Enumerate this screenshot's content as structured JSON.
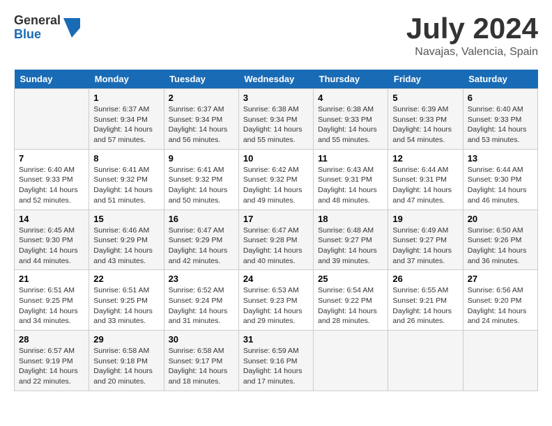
{
  "logo": {
    "general": "General",
    "blue": "Blue"
  },
  "title": "July 2024",
  "subtitle": "Navajas, Valencia, Spain",
  "days_header": [
    "Sunday",
    "Monday",
    "Tuesday",
    "Wednesday",
    "Thursday",
    "Friday",
    "Saturday"
  ],
  "weeks": [
    [
      {
        "day": "",
        "sunrise": "",
        "sunset": "",
        "daylight": ""
      },
      {
        "day": "1",
        "sunrise": "Sunrise: 6:37 AM",
        "sunset": "Sunset: 9:34 PM",
        "daylight": "Daylight: 14 hours and 57 minutes."
      },
      {
        "day": "2",
        "sunrise": "Sunrise: 6:37 AM",
        "sunset": "Sunset: 9:34 PM",
        "daylight": "Daylight: 14 hours and 56 minutes."
      },
      {
        "day": "3",
        "sunrise": "Sunrise: 6:38 AM",
        "sunset": "Sunset: 9:34 PM",
        "daylight": "Daylight: 14 hours and 55 minutes."
      },
      {
        "day": "4",
        "sunrise": "Sunrise: 6:38 AM",
        "sunset": "Sunset: 9:33 PM",
        "daylight": "Daylight: 14 hours and 55 minutes."
      },
      {
        "day": "5",
        "sunrise": "Sunrise: 6:39 AM",
        "sunset": "Sunset: 9:33 PM",
        "daylight": "Daylight: 14 hours and 54 minutes."
      },
      {
        "day": "6",
        "sunrise": "Sunrise: 6:40 AM",
        "sunset": "Sunset: 9:33 PM",
        "daylight": "Daylight: 14 hours and 53 minutes."
      }
    ],
    [
      {
        "day": "7",
        "sunrise": "Sunrise: 6:40 AM",
        "sunset": "Sunset: 9:33 PM",
        "daylight": "Daylight: 14 hours and 52 minutes."
      },
      {
        "day": "8",
        "sunrise": "Sunrise: 6:41 AM",
        "sunset": "Sunset: 9:32 PM",
        "daylight": "Daylight: 14 hours and 51 minutes."
      },
      {
        "day": "9",
        "sunrise": "Sunrise: 6:41 AM",
        "sunset": "Sunset: 9:32 PM",
        "daylight": "Daylight: 14 hours and 50 minutes."
      },
      {
        "day": "10",
        "sunrise": "Sunrise: 6:42 AM",
        "sunset": "Sunset: 9:32 PM",
        "daylight": "Daylight: 14 hours and 49 minutes."
      },
      {
        "day": "11",
        "sunrise": "Sunrise: 6:43 AM",
        "sunset": "Sunset: 9:31 PM",
        "daylight": "Daylight: 14 hours and 48 minutes."
      },
      {
        "day": "12",
        "sunrise": "Sunrise: 6:44 AM",
        "sunset": "Sunset: 9:31 PM",
        "daylight": "Daylight: 14 hours and 47 minutes."
      },
      {
        "day": "13",
        "sunrise": "Sunrise: 6:44 AM",
        "sunset": "Sunset: 9:30 PM",
        "daylight": "Daylight: 14 hours and 46 minutes."
      }
    ],
    [
      {
        "day": "14",
        "sunrise": "Sunrise: 6:45 AM",
        "sunset": "Sunset: 9:30 PM",
        "daylight": "Daylight: 14 hours and 44 minutes."
      },
      {
        "day": "15",
        "sunrise": "Sunrise: 6:46 AM",
        "sunset": "Sunset: 9:29 PM",
        "daylight": "Daylight: 14 hours and 43 minutes."
      },
      {
        "day": "16",
        "sunrise": "Sunrise: 6:47 AM",
        "sunset": "Sunset: 9:29 PM",
        "daylight": "Daylight: 14 hours and 42 minutes."
      },
      {
        "day": "17",
        "sunrise": "Sunrise: 6:47 AM",
        "sunset": "Sunset: 9:28 PM",
        "daylight": "Daylight: 14 hours and 40 minutes."
      },
      {
        "day": "18",
        "sunrise": "Sunrise: 6:48 AM",
        "sunset": "Sunset: 9:27 PM",
        "daylight": "Daylight: 14 hours and 39 minutes."
      },
      {
        "day": "19",
        "sunrise": "Sunrise: 6:49 AM",
        "sunset": "Sunset: 9:27 PM",
        "daylight": "Daylight: 14 hours and 37 minutes."
      },
      {
        "day": "20",
        "sunrise": "Sunrise: 6:50 AM",
        "sunset": "Sunset: 9:26 PM",
        "daylight": "Daylight: 14 hours and 36 minutes."
      }
    ],
    [
      {
        "day": "21",
        "sunrise": "Sunrise: 6:51 AM",
        "sunset": "Sunset: 9:25 PM",
        "daylight": "Daylight: 14 hours and 34 minutes."
      },
      {
        "day": "22",
        "sunrise": "Sunrise: 6:51 AM",
        "sunset": "Sunset: 9:25 PM",
        "daylight": "Daylight: 14 hours and 33 minutes."
      },
      {
        "day": "23",
        "sunrise": "Sunrise: 6:52 AM",
        "sunset": "Sunset: 9:24 PM",
        "daylight": "Daylight: 14 hours and 31 minutes."
      },
      {
        "day": "24",
        "sunrise": "Sunrise: 6:53 AM",
        "sunset": "Sunset: 9:23 PM",
        "daylight": "Daylight: 14 hours and 29 minutes."
      },
      {
        "day": "25",
        "sunrise": "Sunrise: 6:54 AM",
        "sunset": "Sunset: 9:22 PM",
        "daylight": "Daylight: 14 hours and 28 minutes."
      },
      {
        "day": "26",
        "sunrise": "Sunrise: 6:55 AM",
        "sunset": "Sunset: 9:21 PM",
        "daylight": "Daylight: 14 hours and 26 minutes."
      },
      {
        "day": "27",
        "sunrise": "Sunrise: 6:56 AM",
        "sunset": "Sunset: 9:20 PM",
        "daylight": "Daylight: 14 hours and 24 minutes."
      }
    ],
    [
      {
        "day": "28",
        "sunrise": "Sunrise: 6:57 AM",
        "sunset": "Sunset: 9:19 PM",
        "daylight": "Daylight: 14 hours and 22 minutes."
      },
      {
        "day": "29",
        "sunrise": "Sunrise: 6:58 AM",
        "sunset": "Sunset: 9:18 PM",
        "daylight": "Daylight: 14 hours and 20 minutes."
      },
      {
        "day": "30",
        "sunrise": "Sunrise: 6:58 AM",
        "sunset": "Sunset: 9:17 PM",
        "daylight": "Daylight: 14 hours and 18 minutes."
      },
      {
        "day": "31",
        "sunrise": "Sunrise: 6:59 AM",
        "sunset": "Sunset: 9:16 PM",
        "daylight": "Daylight: 14 hours and 17 minutes."
      },
      {
        "day": "",
        "sunrise": "",
        "sunset": "",
        "daylight": ""
      },
      {
        "day": "",
        "sunrise": "",
        "sunset": "",
        "daylight": ""
      },
      {
        "day": "",
        "sunrise": "",
        "sunset": "",
        "daylight": ""
      }
    ]
  ]
}
